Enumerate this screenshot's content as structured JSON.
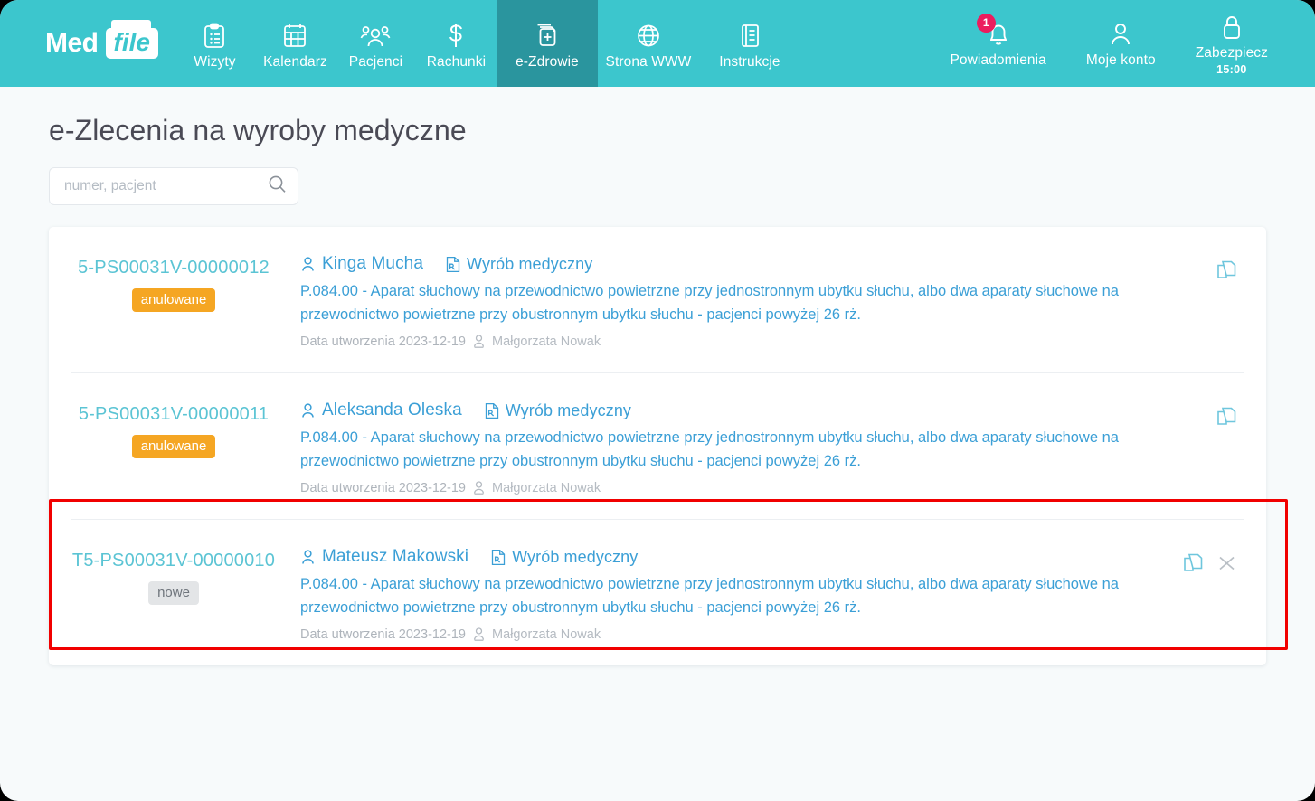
{
  "brand": {
    "part1": "Med",
    "part2": "file"
  },
  "nav": {
    "items": [
      {
        "label": "Wizyty",
        "icon": "clipboard-icon",
        "active": false
      },
      {
        "label": "Kalendarz",
        "icon": "calendar-icon",
        "active": false
      },
      {
        "label": "Pacjenci",
        "icon": "people-icon",
        "active": false
      },
      {
        "label": "Rachunki",
        "icon": "dollar-icon",
        "active": false
      },
      {
        "label": "e-Zdrowie",
        "icon": "medical-file-icon",
        "active": true
      },
      {
        "label": "Strona WWW",
        "icon": "globe-icon",
        "active": false
      },
      {
        "label": "Instrukcje",
        "icon": "book-icon",
        "active": false
      }
    ],
    "right": {
      "notifications": {
        "label": "Powiadomienia",
        "icon": "bell-icon",
        "count": "1"
      },
      "account": {
        "label": "Moje konto",
        "icon": "user-icon"
      },
      "secure": {
        "label": "Zabezpiecz",
        "icon": "lock-icon",
        "timer": "15:00"
      }
    }
  },
  "page": {
    "title": "e-Zlecenia na wyroby medyczne"
  },
  "search": {
    "placeholder": "numer, pacjent",
    "value": "",
    "icon": "search-icon"
  },
  "orders": [
    {
      "number": "5-PS00031V-00000012",
      "status": "anulowane",
      "status_type": "cancelled",
      "patient": "Kinga Mucha",
      "doc_type": "Wyrób medyczny",
      "description": "P.084.00 - Aparat słuchowy na przewodnictwo powietrzne przy jednostronnym ubytku słuchu, albo dwa aparaty słuchowe na przewodnictwo powietrzne przy obustronnym ubytku słuchu - pacjenci powyżej 26 rż.",
      "created_label": "Data utworzenia 2023-12-19",
      "author": "Małgorzata Nowak",
      "actions": [
        "copy-icon"
      ],
      "highlighted": false
    },
    {
      "number": "5-PS00031V-00000011",
      "status": "anulowane",
      "status_type": "cancelled",
      "patient": "Aleksanda Oleska",
      "doc_type": "Wyrób medyczny",
      "description": "P.084.00 - Aparat słuchowy na przewodnictwo powietrzne przy jednostronnym ubytku słuchu, albo dwa aparaty słuchowe na przewodnictwo powietrzne przy obustronnym ubytku słuchu - pacjenci powyżej 26 rż.",
      "created_label": "Data utworzenia 2023-12-19",
      "author": "Małgorzata Nowak",
      "actions": [
        "copy-icon"
      ],
      "highlighted": false
    },
    {
      "number": "T5-PS00031V-00000010",
      "status": "nowe",
      "status_type": "new",
      "patient": "Mateusz Makowski",
      "doc_type": "Wyrób medyczny",
      "description": "P.084.00 - Aparat słuchowy na przewodnictwo powietrzne przy jednostronnym ubytku słuchu, albo dwa aparaty słuchowe na przewodnictwo powietrzne przy obustronnym ubytku słuchu - pacjenci powyżej 26 rż.",
      "created_label": "Data utworzenia 2023-12-19",
      "author": "Małgorzata Nowak",
      "actions": [
        "copy-icon",
        "close-icon"
      ],
      "highlighted": true
    }
  ],
  "colors": {
    "nav_bg": "#3cc6cd",
    "nav_active": "#2a959e",
    "badge_red": "#ec1c5e",
    "status_cancelled": "#f5a623",
    "status_new": "#e3e5e7",
    "link_blue": "#3b9fd6",
    "number_teal": "#5bc4d4",
    "highlight_red": "#f10000",
    "page_bg": "#f7fafb"
  }
}
